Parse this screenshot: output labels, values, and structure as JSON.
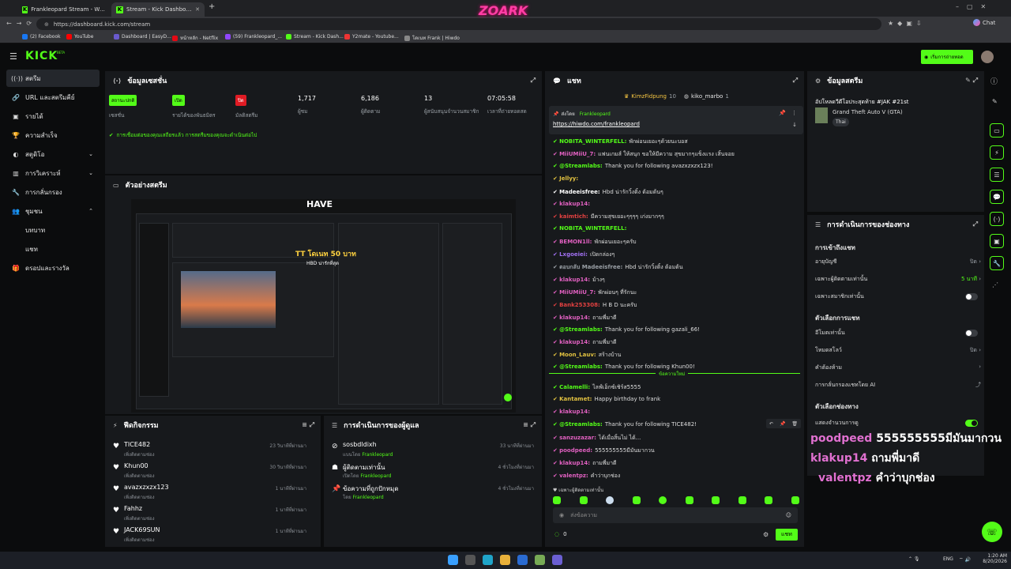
{
  "browser": {
    "tabs": [
      {
        "label": "Frankleopard Stream - Watch Live"
      },
      {
        "label": "Stream - Kick Dashboard"
      }
    ],
    "new_tab": "+",
    "url": "https://dashboard.kick.com/stream",
    "chat_label": "Chat",
    "bookmarks": [
      "(2) Facebook",
      "YouTube",
      "Dashboard | EasyD...",
      "หน้าหลัก - Netflix",
      "(59) Frankleopard_...",
      "Stream - Kick Dash...",
      "Y2mate - Youtube...",
      "โดเนท Frank | Hiwdo"
    ]
  },
  "header": {
    "logo": "KICK",
    "beta": "BETA",
    "watch_button": "เริ่มการถ่ายทอด"
  },
  "sidebar": {
    "items": [
      {
        "label": "สตรีม",
        "icon": "radio-icon"
      },
      {
        "label": "URL และสตรีมคีย์",
        "icon": "link-icon"
      },
      {
        "label": "รายได้",
        "icon": "wallet-icon"
      },
      {
        "label": "ความสำเร็จ",
        "icon": "trophy-icon"
      },
      {
        "label": "สตูดิโอ",
        "icon": "palette-icon"
      },
      {
        "label": "การวิเคราะห์",
        "icon": "chart-icon"
      },
      {
        "label": "การกลั่นกรอง",
        "icon": "wrench-icon"
      },
      {
        "label": "ชุมชน",
        "icon": "users-icon"
      },
      {
        "label": "บทบาท",
        "icon": ""
      },
      {
        "label": "แชท",
        "icon": ""
      },
      {
        "label": "ดรอปและรางวัล",
        "icon": "gift-icon"
      }
    ]
  },
  "session": {
    "title": "ข้อมูลเซสชั่น",
    "stats": [
      {
        "badge": "สถานะปกติ",
        "label": "เซสชั่น"
      },
      {
        "badge": "เปิด",
        "label": "รายได้ของพันธมิตร"
      },
      {
        "badge": "ปิด",
        "label": "มัลติสตรีม"
      },
      {
        "num": "1,717",
        "label": "ผู้ชม"
      },
      {
        "num": "6,186",
        "label": "ผู้ติดตาม"
      },
      {
        "num": "13",
        "label": "ผู้สนับสนุนจำนวนสมาชิก"
      },
      {
        "num": "07:05:58",
        "label": "เวลาที่ถ่ายทอดสด"
      }
    ],
    "status": "การเชื่อมต่อของคุณเสถียรแล้ว การสตรีมของคุณจะดำเนินต่อไป"
  },
  "preview": {
    "title": "ตัวอย่างสตรีม",
    "overlay_brand": "HAVE",
    "overlay_text": "TT โดเนท 50 บาท",
    "overlay_sub": "HBD น่ารักที่สุด"
  },
  "activity": {
    "title": "ฟีดกิจกรรม",
    "items": [
      {
        "name": "TICE482",
        "sub": "เพิ่งติดตามช่อง",
        "time": "23 วินาทีที่ผ่านมา"
      },
      {
        "name": "Khun00",
        "sub": "เพิ่งติดตามช่อง",
        "time": "30 วินาทีที่ผ่านมา"
      },
      {
        "name": "avazxzxzx123",
        "sub": "เพิ่งติดตามช่อง",
        "time": "1 นาทีที่ผ่านมา"
      },
      {
        "name": "Fahhz",
        "sub": "เพิ่งติดตามช่อง",
        "time": "1 นาทีที่ผ่านมา"
      },
      {
        "name": "JACK69SUN",
        "sub": "เพิ่งติดตามช่อง",
        "time": "1 นาทีที่ผ่านมา"
      }
    ]
  },
  "modlog": {
    "title": "การดำเนินการของผู้ดูแล",
    "items": [
      {
        "name": "sosbdldixh",
        "sub": "แบนโดย",
        "by": "Frankleopard",
        "time": "33 นาทีที่ผ่านมา"
      },
      {
        "name": "ผู้ติดตามเท่านั้น",
        "sub": "เปิดโดย",
        "by": "Frankleopard",
        "time": "4 ชั่วโมงที่ผ่านมา"
      },
      {
        "name": "ข้อความที่ถูกปักหมุด",
        "sub": "โดย",
        "by": "Frankleopard",
        "time": "4 ชั่วโมงที่ผ่านมา"
      }
    ]
  },
  "chat": {
    "title": "แชท",
    "top_users": [
      {
        "name": "KimzFidpung",
        "count": "10"
      },
      {
        "name": "kiko_marbo",
        "count": "1"
      }
    ],
    "pinned": {
      "label": "ส่งโดย",
      "by": "Frankleopard",
      "link": "https://hiwdo.com/frankleopard"
    },
    "messages": [
      {
        "user": "NOBITA_WINTERFELL:",
        "color": "#53fc18",
        "text": "พักผ่อนเยอะๆด้วยนะบอส"
      },
      {
        "user": "MiiUMiiU_7:",
        "color": "#e060c0",
        "text": "แฟนเกมส์ ให้สนุก ขอให้มีความ สุขมากๆแข็งแรง เสิ้นจอย"
      },
      {
        "user": "@Streamlabs:",
        "color": "#53fc18",
        "text": "Thank you for following avazxzxzx123!"
      },
      {
        "user": "Jellyy:",
        "color": "#e0c040",
        "text": ""
      },
      {
        "user": "Madeeisfree:",
        "color": "#ffffff",
        "text": "Hbd น่ารักวิ้งติ้ง ต้อมต้นๆ"
      },
      {
        "user": "klakup14:",
        "color": "#e060c0",
        "text": ""
      },
      {
        "user": "kaimtich:",
        "color": "#e04040",
        "text": "มีความสุขเยอะๆๆๆๆ เก่งมากๆๆ"
      },
      {
        "user": "NOBITA_WINTERFELL:",
        "color": "#53fc18",
        "text": ""
      },
      {
        "user": "BEMON1ll:",
        "color": "#e060c0",
        "text": "พักผ่อนเยอะๆครับ"
      },
      {
        "user": "Lxgoeiei:",
        "color": "#a070f0",
        "text": "เปิดกล่องๆ"
      },
      {
        "user": "ตอบกลับ Madeeisfree:",
        "color": "#9aa0a6",
        "text": "Hbd น่ารักวิ้งติ้ง ต้อมต้น"
      },
      {
        "user": "klakup14:",
        "color": "#e060c0",
        "text": "ม้างๆ"
      },
      {
        "user": "MiiUMiiU_7:",
        "color": "#e060c0",
        "text": "พักผ่อนๆ ที่รักนะ"
      },
      {
        "user": "Bank253308:",
        "color": "#e04040",
        "text": "H B D นะครับ"
      },
      {
        "user": "klakup14:",
        "color": "#e060c0",
        "text": "ถามพี่มาดี"
      },
      {
        "user": "@Streamlabs:",
        "color": "#53fc18",
        "text": "Thank you for following gazali_66!"
      },
      {
        "user": "klakup14:",
        "color": "#e060c0",
        "text": "ถามพี่มาดี"
      },
      {
        "user": "Moon_Lauv:",
        "color": "#e0c040",
        "text": "สร้างบ้าน"
      },
      {
        "user": "@Streamlabs:",
        "color": "#53fc18",
        "text": "Thank you for following Khun00!"
      }
    ],
    "new_messages": "ข้อความใหม่",
    "messages2": [
      {
        "user": "Calamelli:",
        "color": "#53fc18",
        "text": "ไลฟ์เอ็กซ์เชิร์ส5555"
      },
      {
        "user": "Kantamet:",
        "color": "#e0c040",
        "text": "Happy birthday to frank"
      },
      {
        "user": "klakup14:",
        "color": "#e060c0",
        "text": ""
      },
      {
        "user": "@Streamlabs:",
        "color": "#53fc18",
        "text": "Thank you for following TICE482!"
      },
      {
        "user": "sanzuzazar:",
        "color": "#e060c0",
        "text": "ได้เมื่อสิ้นไม่ ได้..."
      },
      {
        "user": "poodpeed:",
        "color": "#e060c0",
        "text": "555555555มีมันมากวน"
      },
      {
        "user": "klakup14:",
        "color": "#e060c0",
        "text": "ถามพี่มาดี"
      },
      {
        "user": "valentpz:",
        "color": "#e060c0",
        "text": "คำว่าบุกช่อง"
      }
    ],
    "followers_only": "เฉพาะผู้ติดตามเท่านั้น",
    "input_placeholder": "ส่งข้อความ",
    "count": "0",
    "send": "แชท"
  },
  "stream_info": {
    "title": "ข้อมูลสตรีม",
    "stream_title": "อัปโหลดวีดีโอประสุดท้าย #JAK #21st",
    "game": "Grand Theft Auto V (GTA)",
    "tag": "Thai"
  },
  "channel_actions": {
    "title": "การดำเนินการของช่องทาง",
    "sec1": "การเข้าถึงแชท",
    "rows1": [
      {
        "label": "อายุบัญชี",
        "value": "ปิด"
      },
      {
        "label": "เฉพาะผู้ติดตามเท่านั้น",
        "value": "5 นาที"
      },
      {
        "label": "เฉพาะสมาชิกเท่านั้น",
        "value": ""
      }
    ],
    "sec2": "ตัวเลือกการแชท",
    "rows2": [
      {
        "label": "อีโมตเท่านั้น",
        "value": ""
      },
      {
        "label": "โหมดสโลว์",
        "value": "ปิด"
      },
      {
        "label": "คำต้องห้าม",
        "value": ""
      },
      {
        "label": "การกลั่นกรองแชทโดย AI",
        "value": ""
      }
    ],
    "sec3": "ตัวเลือกช่องทาง",
    "rows3": [
      {
        "label": "แสดงจำนวนการดู",
        "value": ""
      }
    ]
  },
  "overlay_chat": [
    {
      "user": "poodpeed",
      "text": "555555555มีมันมากวน",
      "color": "#e070d0"
    },
    {
      "user": "klakup14",
      "text": "ถามพี่มาดี",
      "color": "#e070d0"
    },
    {
      "user": "valentpz",
      "text": "คำว่าบุกช่อง",
      "color": "#e070d0"
    }
  ],
  "taskbar": {
    "lang": "ENG",
    "time": "1:20 AM",
    "date": "8/20/2026"
  },
  "colors": {
    "accent": "#53fc18",
    "panel": "#17191c",
    "bg": "#0b0c0d"
  }
}
